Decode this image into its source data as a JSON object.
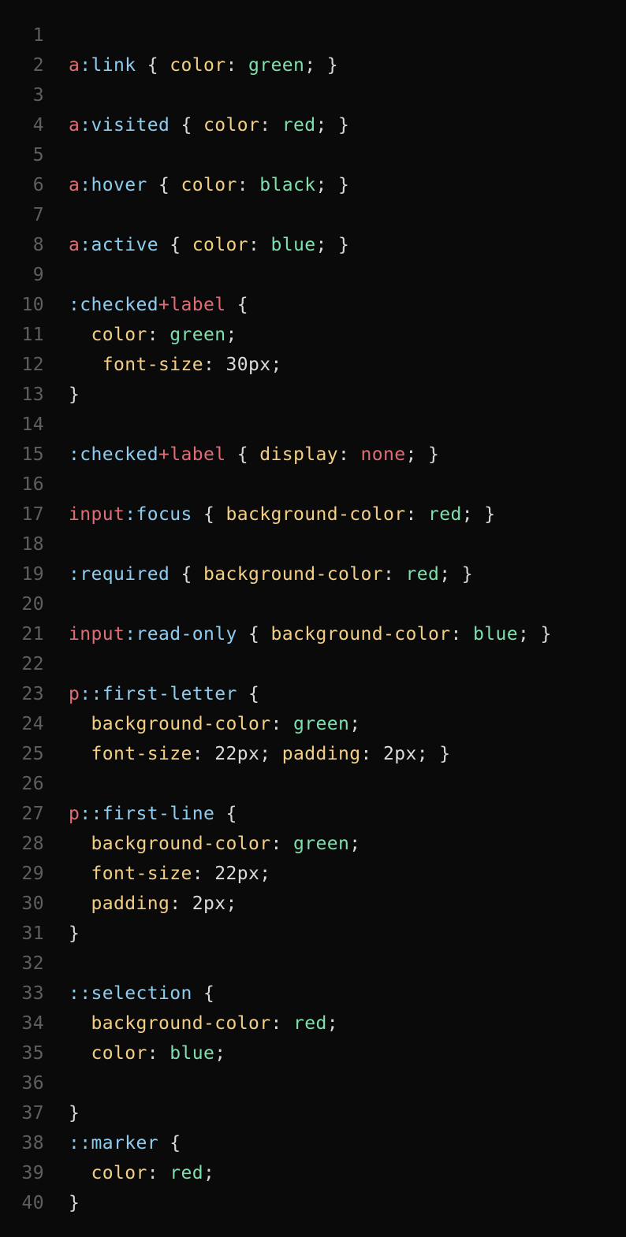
{
  "editor": {
    "lines": [
      {
        "n": "1",
        "tokens": []
      },
      {
        "n": "2",
        "tokens": [
          [
            "tag",
            "a"
          ],
          [
            "pseudo",
            ":link"
          ],
          [
            "punc",
            " { "
          ],
          [
            "prop",
            "color"
          ],
          [
            "punc",
            ": "
          ],
          [
            "val",
            "green"
          ],
          [
            "punc",
            "; }"
          ]
        ]
      },
      {
        "n": "3",
        "tokens": []
      },
      {
        "n": "4",
        "tokens": [
          [
            "tag",
            "a"
          ],
          [
            "pseudo",
            ":visited"
          ],
          [
            "punc",
            " { "
          ],
          [
            "prop",
            "color"
          ],
          [
            "punc",
            ": "
          ],
          [
            "val",
            "red"
          ],
          [
            "punc",
            "; }"
          ]
        ]
      },
      {
        "n": "5",
        "tokens": []
      },
      {
        "n": "6",
        "tokens": [
          [
            "tag",
            "a"
          ],
          [
            "pseudo",
            ":hover"
          ],
          [
            "punc",
            " { "
          ],
          [
            "prop",
            "color"
          ],
          [
            "punc",
            ": "
          ],
          [
            "val",
            "black"
          ],
          [
            "punc",
            "; }"
          ]
        ]
      },
      {
        "n": "7",
        "tokens": []
      },
      {
        "n": "8",
        "tokens": [
          [
            "tag",
            "a"
          ],
          [
            "pseudo",
            ":active"
          ],
          [
            "punc",
            " { "
          ],
          [
            "prop",
            "color"
          ],
          [
            "punc",
            ": "
          ],
          [
            "val",
            "blue"
          ],
          [
            "punc",
            "; }"
          ]
        ]
      },
      {
        "n": "9",
        "tokens": []
      },
      {
        "n": "10",
        "tokens": [
          [
            "pseudo",
            ":checked"
          ],
          [
            "tag",
            "+label"
          ],
          [
            "punc",
            " {"
          ]
        ]
      },
      {
        "n": "11",
        "tokens": [
          [
            "punc",
            "  "
          ],
          [
            "prop",
            "color"
          ],
          [
            "punc",
            ": "
          ],
          [
            "val",
            "green"
          ],
          [
            "punc",
            ";"
          ]
        ]
      },
      {
        "n": "12",
        "tokens": [
          [
            "punc",
            "   "
          ],
          [
            "prop",
            "font-size"
          ],
          [
            "punc",
            ": "
          ],
          [
            "num",
            "30px"
          ],
          [
            "punc",
            ";"
          ]
        ]
      },
      {
        "n": "13",
        "tokens": [
          [
            "punc",
            "}"
          ]
        ]
      },
      {
        "n": "14",
        "tokens": []
      },
      {
        "n": "15",
        "tokens": [
          [
            "pseudo",
            ":checked"
          ],
          [
            "tag",
            "+label"
          ],
          [
            "punc",
            " { "
          ],
          [
            "prop",
            "display"
          ],
          [
            "punc",
            ": "
          ],
          [
            "kw",
            "none"
          ],
          [
            "punc",
            "; }"
          ]
        ]
      },
      {
        "n": "16",
        "tokens": []
      },
      {
        "n": "17",
        "tokens": [
          [
            "tag",
            "input"
          ],
          [
            "pseudo",
            ":focus"
          ],
          [
            "punc",
            " { "
          ],
          [
            "prop",
            "background-color"
          ],
          [
            "punc",
            ": "
          ],
          [
            "val",
            "red"
          ],
          [
            "punc",
            "; }"
          ]
        ]
      },
      {
        "n": "18",
        "tokens": []
      },
      {
        "n": "19",
        "tokens": [
          [
            "pseudo",
            ":required"
          ],
          [
            "punc",
            " { "
          ],
          [
            "prop",
            "background-color"
          ],
          [
            "punc",
            ": "
          ],
          [
            "val",
            "red"
          ],
          [
            "punc",
            "; }"
          ]
        ]
      },
      {
        "n": "20",
        "tokens": []
      },
      {
        "n": "21",
        "tokens": [
          [
            "tag",
            "input"
          ],
          [
            "pseudo",
            ":read-only"
          ],
          [
            "punc",
            " { "
          ],
          [
            "prop",
            "background-color"
          ],
          [
            "punc",
            ": "
          ],
          [
            "val",
            "blue"
          ],
          [
            "punc",
            "; }"
          ]
        ]
      },
      {
        "n": "22",
        "tokens": []
      },
      {
        "n": "23",
        "tokens": [
          [
            "tag",
            "p"
          ],
          [
            "pseudo",
            "::first-letter"
          ],
          [
            "punc",
            " {"
          ]
        ]
      },
      {
        "n": "24",
        "tokens": [
          [
            "punc",
            "  "
          ],
          [
            "prop",
            "background-color"
          ],
          [
            "punc",
            ": "
          ],
          [
            "val",
            "green"
          ],
          [
            "punc",
            ";"
          ]
        ]
      },
      {
        "n": "25",
        "tokens": [
          [
            "punc",
            "  "
          ],
          [
            "prop",
            "font-size"
          ],
          [
            "punc",
            ": "
          ],
          [
            "num",
            "22px"
          ],
          [
            "punc",
            "; "
          ],
          [
            "prop",
            "padding"
          ],
          [
            "punc",
            ": "
          ],
          [
            "num",
            "2px"
          ],
          [
            "punc",
            "; }"
          ]
        ]
      },
      {
        "n": "26",
        "tokens": []
      },
      {
        "n": "27",
        "tokens": [
          [
            "tag",
            "p"
          ],
          [
            "pseudo",
            "::first-line"
          ],
          [
            "punc",
            " {"
          ]
        ]
      },
      {
        "n": "28",
        "tokens": [
          [
            "punc",
            "  "
          ],
          [
            "prop",
            "background-color"
          ],
          [
            "punc",
            ": "
          ],
          [
            "val",
            "green"
          ],
          [
            "punc",
            ";"
          ]
        ]
      },
      {
        "n": "29",
        "tokens": [
          [
            "punc",
            "  "
          ],
          [
            "prop",
            "font-size"
          ],
          [
            "punc",
            ": "
          ],
          [
            "num",
            "22px"
          ],
          [
            "punc",
            ";"
          ]
        ]
      },
      {
        "n": "30",
        "tokens": [
          [
            "punc",
            "  "
          ],
          [
            "prop",
            "padding"
          ],
          [
            "punc",
            ": "
          ],
          [
            "num",
            "2px"
          ],
          [
            "punc",
            ";"
          ]
        ]
      },
      {
        "n": "31",
        "tokens": [
          [
            "punc",
            "}"
          ]
        ]
      },
      {
        "n": "32",
        "tokens": []
      },
      {
        "n": "33",
        "tokens": [
          [
            "pseudo",
            "::selection"
          ],
          [
            "punc",
            " {"
          ]
        ]
      },
      {
        "n": "34",
        "tokens": [
          [
            "punc",
            "  "
          ],
          [
            "prop",
            "background-color"
          ],
          [
            "punc",
            ": "
          ],
          [
            "val",
            "red"
          ],
          [
            "punc",
            ";"
          ]
        ]
      },
      {
        "n": "35",
        "tokens": [
          [
            "punc",
            "  "
          ],
          [
            "prop",
            "color"
          ],
          [
            "punc",
            ": "
          ],
          [
            "val",
            "blue"
          ],
          [
            "punc",
            ";"
          ]
        ]
      },
      {
        "n": "36",
        "tokens": []
      },
      {
        "n": "37",
        "tokens": [
          [
            "punc",
            "}"
          ]
        ]
      },
      {
        "n": "38",
        "tokens": [
          [
            "pseudo",
            "::marker"
          ],
          [
            "punc",
            " {"
          ]
        ]
      },
      {
        "n": "39",
        "tokens": [
          [
            "punc",
            "  "
          ],
          [
            "prop",
            "color"
          ],
          [
            "punc",
            ": "
          ],
          [
            "val",
            "red"
          ],
          [
            "punc",
            ";"
          ]
        ]
      },
      {
        "n": "40",
        "tokens": [
          [
            "punc",
            "}"
          ]
        ]
      }
    ]
  },
  "colors": {
    "background": "#0a0a0a",
    "line_number": "#5f5f5f",
    "selector_tag": "#e06c75",
    "pseudo_class": "#8fcdf0",
    "property": "#f2cf85",
    "value": "#7ee0ac",
    "punctuation": "#d8d8d8"
  }
}
